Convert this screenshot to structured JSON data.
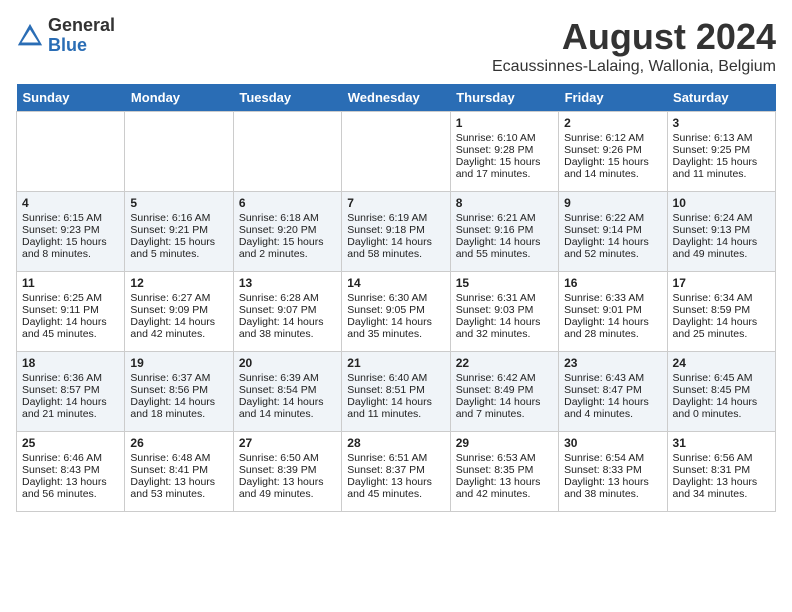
{
  "logo": {
    "general": "General",
    "blue": "Blue"
  },
  "title": "August 2024",
  "subtitle": "Ecaussinnes-Lalaing, Wallonia, Belgium",
  "days_of_week": [
    "Sunday",
    "Monday",
    "Tuesday",
    "Wednesday",
    "Thursday",
    "Friday",
    "Saturday"
  ],
  "weeks": [
    [
      {
        "day": "",
        "content": ""
      },
      {
        "day": "",
        "content": ""
      },
      {
        "day": "",
        "content": ""
      },
      {
        "day": "",
        "content": ""
      },
      {
        "day": "1",
        "content": "Sunrise: 6:10 AM\nSunset: 9:28 PM\nDaylight: 15 hours and 17 minutes."
      },
      {
        "day": "2",
        "content": "Sunrise: 6:12 AM\nSunset: 9:26 PM\nDaylight: 15 hours and 14 minutes."
      },
      {
        "day": "3",
        "content": "Sunrise: 6:13 AM\nSunset: 9:25 PM\nDaylight: 15 hours and 11 minutes."
      }
    ],
    [
      {
        "day": "4",
        "content": "Sunrise: 6:15 AM\nSunset: 9:23 PM\nDaylight: 15 hours and 8 minutes."
      },
      {
        "day": "5",
        "content": "Sunrise: 6:16 AM\nSunset: 9:21 PM\nDaylight: 15 hours and 5 minutes."
      },
      {
        "day": "6",
        "content": "Sunrise: 6:18 AM\nSunset: 9:20 PM\nDaylight: 15 hours and 2 minutes."
      },
      {
        "day": "7",
        "content": "Sunrise: 6:19 AM\nSunset: 9:18 PM\nDaylight: 14 hours and 58 minutes."
      },
      {
        "day": "8",
        "content": "Sunrise: 6:21 AM\nSunset: 9:16 PM\nDaylight: 14 hours and 55 minutes."
      },
      {
        "day": "9",
        "content": "Sunrise: 6:22 AM\nSunset: 9:14 PM\nDaylight: 14 hours and 52 minutes."
      },
      {
        "day": "10",
        "content": "Sunrise: 6:24 AM\nSunset: 9:13 PM\nDaylight: 14 hours and 49 minutes."
      }
    ],
    [
      {
        "day": "11",
        "content": "Sunrise: 6:25 AM\nSunset: 9:11 PM\nDaylight: 14 hours and 45 minutes."
      },
      {
        "day": "12",
        "content": "Sunrise: 6:27 AM\nSunset: 9:09 PM\nDaylight: 14 hours and 42 minutes."
      },
      {
        "day": "13",
        "content": "Sunrise: 6:28 AM\nSunset: 9:07 PM\nDaylight: 14 hours and 38 minutes."
      },
      {
        "day": "14",
        "content": "Sunrise: 6:30 AM\nSunset: 9:05 PM\nDaylight: 14 hours and 35 minutes."
      },
      {
        "day": "15",
        "content": "Sunrise: 6:31 AM\nSunset: 9:03 PM\nDaylight: 14 hours and 32 minutes."
      },
      {
        "day": "16",
        "content": "Sunrise: 6:33 AM\nSunset: 9:01 PM\nDaylight: 14 hours and 28 minutes."
      },
      {
        "day": "17",
        "content": "Sunrise: 6:34 AM\nSunset: 8:59 PM\nDaylight: 14 hours and 25 minutes."
      }
    ],
    [
      {
        "day": "18",
        "content": "Sunrise: 6:36 AM\nSunset: 8:57 PM\nDaylight: 14 hours and 21 minutes."
      },
      {
        "day": "19",
        "content": "Sunrise: 6:37 AM\nSunset: 8:56 PM\nDaylight: 14 hours and 18 minutes."
      },
      {
        "day": "20",
        "content": "Sunrise: 6:39 AM\nSunset: 8:54 PM\nDaylight: 14 hours and 14 minutes."
      },
      {
        "day": "21",
        "content": "Sunrise: 6:40 AM\nSunset: 8:51 PM\nDaylight: 14 hours and 11 minutes."
      },
      {
        "day": "22",
        "content": "Sunrise: 6:42 AM\nSunset: 8:49 PM\nDaylight: 14 hours and 7 minutes."
      },
      {
        "day": "23",
        "content": "Sunrise: 6:43 AM\nSunset: 8:47 PM\nDaylight: 14 hours and 4 minutes."
      },
      {
        "day": "24",
        "content": "Sunrise: 6:45 AM\nSunset: 8:45 PM\nDaylight: 14 hours and 0 minutes."
      }
    ],
    [
      {
        "day": "25",
        "content": "Sunrise: 6:46 AM\nSunset: 8:43 PM\nDaylight: 13 hours and 56 minutes."
      },
      {
        "day": "26",
        "content": "Sunrise: 6:48 AM\nSunset: 8:41 PM\nDaylight: 13 hours and 53 minutes."
      },
      {
        "day": "27",
        "content": "Sunrise: 6:50 AM\nSunset: 8:39 PM\nDaylight: 13 hours and 49 minutes."
      },
      {
        "day": "28",
        "content": "Sunrise: 6:51 AM\nSunset: 8:37 PM\nDaylight: 13 hours and 45 minutes."
      },
      {
        "day": "29",
        "content": "Sunrise: 6:53 AM\nSunset: 8:35 PM\nDaylight: 13 hours and 42 minutes."
      },
      {
        "day": "30",
        "content": "Sunrise: 6:54 AM\nSunset: 8:33 PM\nDaylight: 13 hours and 38 minutes."
      },
      {
        "day": "31",
        "content": "Sunrise: 6:56 AM\nSunset: 8:31 PM\nDaylight: 13 hours and 34 minutes."
      }
    ]
  ]
}
